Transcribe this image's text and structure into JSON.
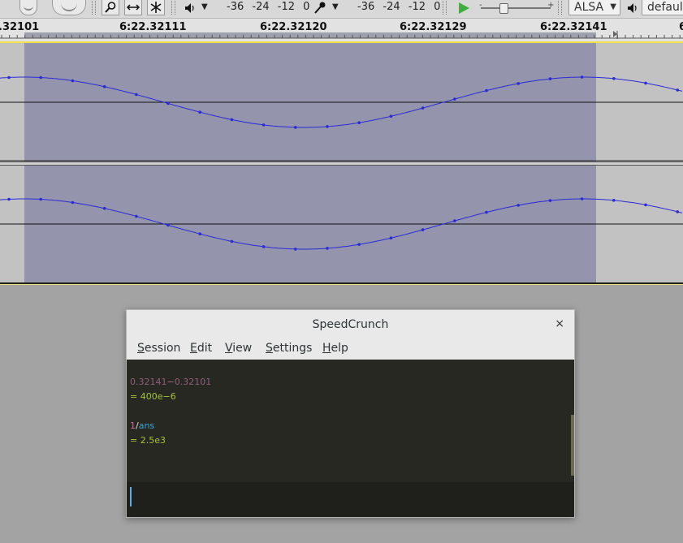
{
  "toolbar": {
    "meter_record": [
      "-36",
      "-24",
      "-12",
      "0"
    ],
    "meter_play": [
      "-36",
      "-24",
      "-12",
      "0"
    ],
    "host": "ALSA",
    "device": "default"
  },
  "ruler": {
    "labels": [
      ".32101",
      "6:22.32111",
      "6:22.32120",
      "6:22.32129",
      "6:22.32141",
      "6"
    ]
  },
  "colors": {
    "selection": "#9494ad",
    "track_bg": "#c2c2c2",
    "waveform": "#2a2ad8",
    "calc_bg": "#272822",
    "expr_number": "#8e5f7a",
    "expr_op": "#d33682",
    "ident": "#3aa6d8",
    "result": "#a6c23a"
  },
  "speedcrunch": {
    "title": "SpeedCrunch",
    "close": "×",
    "menu": [
      {
        "key": "S",
        "rest": "ession"
      },
      {
        "key": "E",
        "rest": "dit"
      },
      {
        "key": "V",
        "rest": "iew"
      },
      {
        "key": "S",
        "rest": "ettings"
      },
      {
        "key": "H",
        "rest": "elp"
      }
    ],
    "history": [
      {
        "a": "0.32141",
        "op": "−",
        "b": "0.32101",
        "result": "= 400e−6"
      },
      {
        "a": "1",
        "op": "/",
        "b": "ans",
        "result": "= 2.5e3"
      }
    ],
    "input_value": ""
  }
}
